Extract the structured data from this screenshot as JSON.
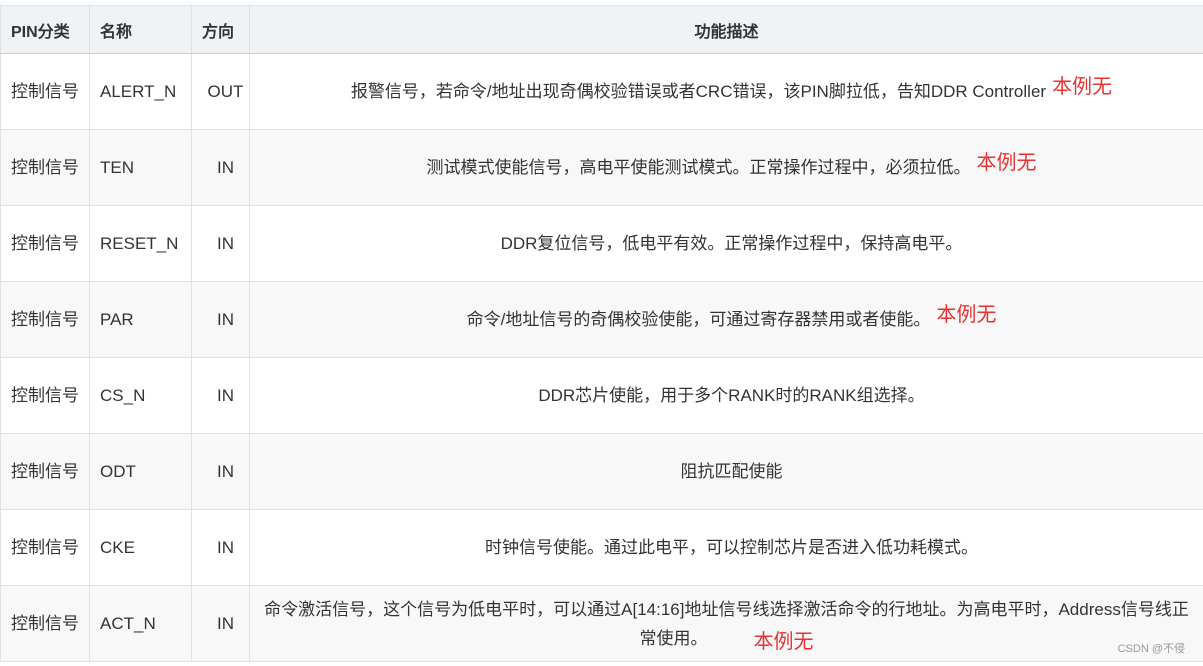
{
  "table": {
    "headers": {
      "category": "PIN分类",
      "name": "名称",
      "direction": "方向",
      "description": "功能描述"
    },
    "rows": [
      {
        "category": "控制信号",
        "name": "ALERT_N",
        "direction": "OUT",
        "description": "报警信号，若命令/地址出现奇偶校验错误或者CRC错误，该PIN脚拉低，告知DDR Controller",
        "note": "本例无"
      },
      {
        "category": "控制信号",
        "name": "TEN",
        "direction": "IN",
        "description": "测试模式使能信号，高电平使能测试模式。正常操作过程中，必须拉低。",
        "note": "本例无"
      },
      {
        "category": "控制信号",
        "name": "RESET_N",
        "direction": "IN",
        "description": "DDR复位信号，低电平有效。正常操作过程中，保持高电平。",
        "note": ""
      },
      {
        "category": "控制信号",
        "name": "PAR",
        "direction": "IN",
        "description": "命令/地址信号的奇偶校验使能，可通过寄存器禁用或者使能。",
        "note": "本例无"
      },
      {
        "category": "控制信号",
        "name": "CS_N",
        "direction": "IN",
        "description": "DDR芯片使能，用于多个RANK时的RANK组选择。",
        "note": ""
      },
      {
        "category": "控制信号",
        "name": "ODT",
        "direction": "IN",
        "description": "阻抗匹配使能",
        "note": ""
      },
      {
        "category": "控制信号",
        "name": "CKE",
        "direction": "IN",
        "description": "时钟信号使能。通过此电平，可以控制芯片是否进入低功耗模式。",
        "note": ""
      },
      {
        "category": "控制信号",
        "name": "ACT_N",
        "direction": "IN",
        "description": "命令激活信号，这个信号为低电平时，可以通过A[14:16]地址信号线选择激活命令的行地址。为高电平时，Address信号线正常使用。",
        "note": "本例无"
      }
    ]
  },
  "watermark": "CSDN @不侵",
  "colors": {
    "header_bg": "#eff3f5",
    "stripe_bg": "#f8f8f8",
    "border": "#dfe2e5",
    "note_red": "#e53333"
  }
}
